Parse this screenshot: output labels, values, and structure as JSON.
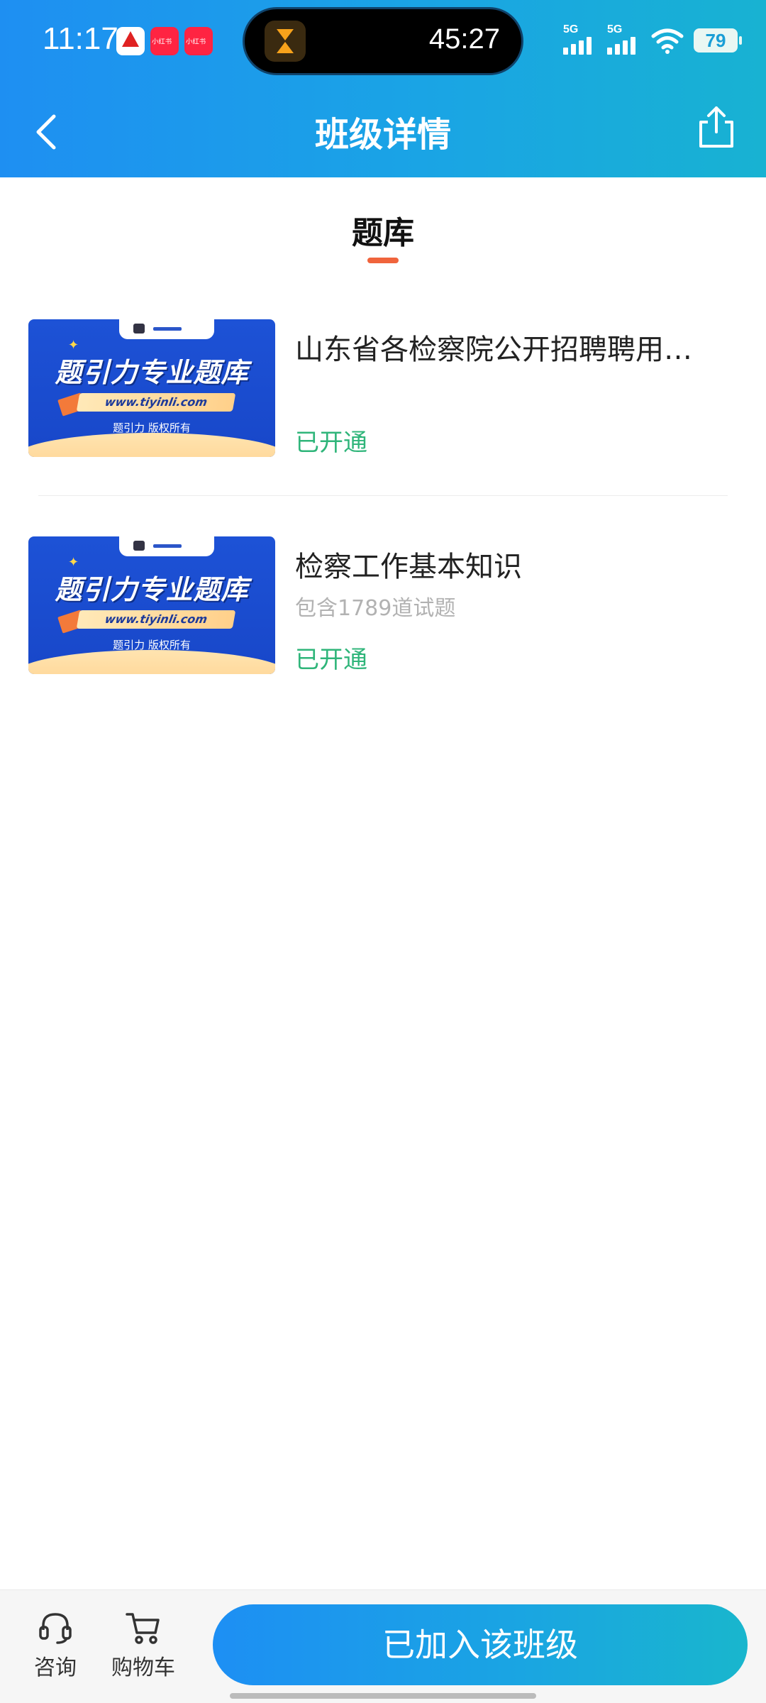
{
  "status_bar": {
    "time": "11:17",
    "timer": "45:27",
    "network_1": "5G",
    "network_2": "5G",
    "battery": "79"
  },
  "header": {
    "title": "班级详情"
  },
  "tab": {
    "label": "题库"
  },
  "thumbnail": {
    "banner_text": "题引力专业题库",
    "url": "www.tiyinli.com",
    "copyright": "题引力 版权所有"
  },
  "items": [
    {
      "title": "山东省各检察院公开招聘聘用…",
      "subtitle": "",
      "status": "已开通"
    },
    {
      "title": "检察工作基本知识",
      "subtitle": "包含1789道试题",
      "status": "已开通"
    }
  ],
  "bottom_bar": {
    "consult_label": "咨询",
    "cart_label": "购物车",
    "join_button": "已加入该班级"
  },
  "colors": {
    "header_gradient_start": "#1e8ff2",
    "header_gradient_end": "#18b2d2",
    "accent_indicator": "#f0643c",
    "status_green": "#2fb57a"
  }
}
